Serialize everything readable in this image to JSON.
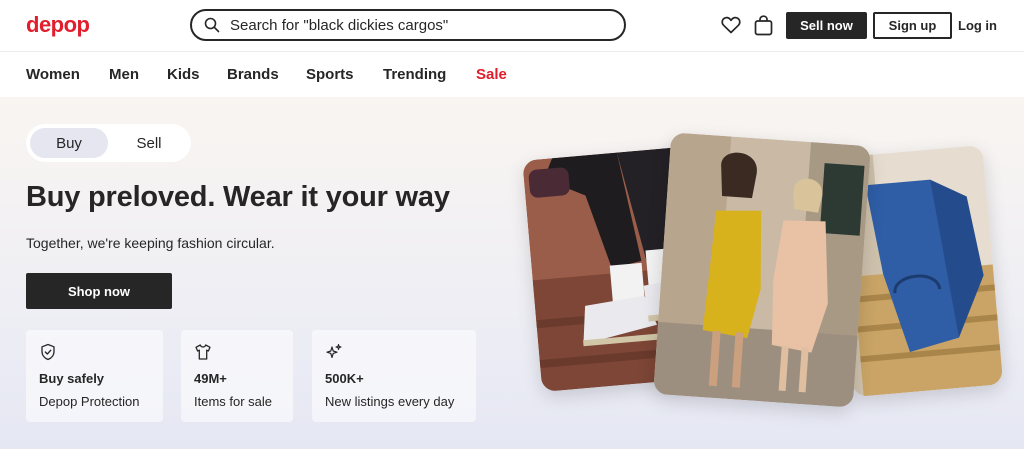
{
  "header": {
    "logo": "depop",
    "search_placeholder": "Search for \"black dickies cargos\"",
    "sell_now": "Sell now",
    "sign_up": "Sign up",
    "log_in": "Log in"
  },
  "nav": {
    "items": [
      "Women",
      "Men",
      "Kids",
      "Brands",
      "Sports",
      "Trending",
      "Sale"
    ]
  },
  "hero": {
    "toggle": {
      "buy": "Buy",
      "sell": "Sell"
    },
    "title": "Buy preloved. Wear it your way",
    "subtitle": "Together, we're keeping fashion circular.",
    "cta": "Shop now",
    "cards": [
      {
        "icon": "shield-icon",
        "title": "Buy safely",
        "desc": "Depop Protection"
      },
      {
        "icon": "tshirt-icon",
        "title": "49M+",
        "desc": "Items for sale"
      },
      {
        "icon": "sparkle-icon",
        "title": "500K+",
        "desc": "New listings every day"
      }
    ]
  },
  "colors": {
    "brand": "#e21e2d",
    "dark": "#262626"
  }
}
